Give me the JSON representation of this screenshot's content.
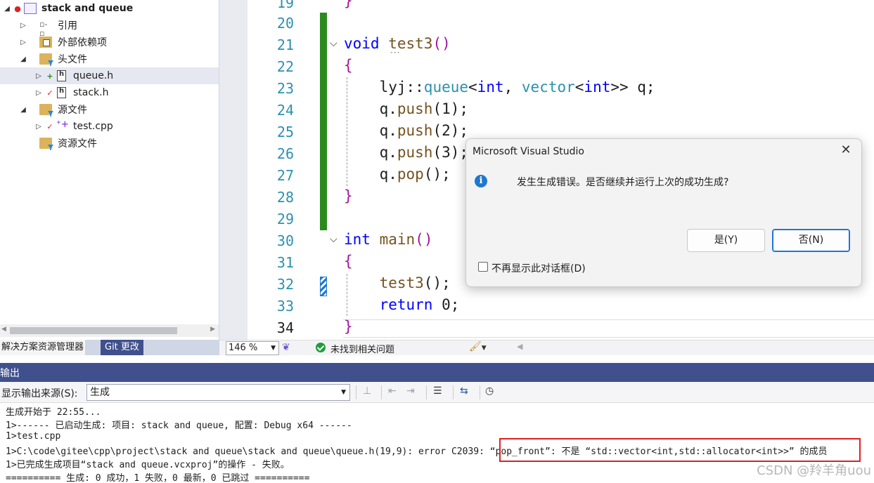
{
  "solution_explorer": {
    "project": "stack and queue",
    "items": [
      {
        "label": "stack and queue",
        "kind": "project"
      },
      {
        "label": "引用",
        "kind": "references"
      },
      {
        "label": "外部依赖项",
        "kind": "external"
      },
      {
        "label": "头文件",
        "kind": "folder"
      },
      {
        "label": "queue.h",
        "kind": "header",
        "status": "+"
      },
      {
        "label": "stack.h",
        "kind": "header",
        "status": "✓"
      },
      {
        "label": "源文件",
        "kind": "folder"
      },
      {
        "label": "test.cpp",
        "kind": "source",
        "status": "✓"
      },
      {
        "label": "资源文件",
        "kind": "folder"
      }
    ],
    "tabs": {
      "explorer": "解决方案资源管理器",
      "git": "Git 更改"
    }
  },
  "editor": {
    "line_numbers": [
      "19",
      "20",
      "21",
      "22",
      "23",
      "24",
      "25",
      "26",
      "27",
      "28",
      "29",
      "30",
      "31",
      "32",
      "33",
      "34"
    ],
    "lines": {
      "l21": {
        "kw": "void",
        "fn": "test3",
        "par": "()"
      },
      "l22": "{",
      "l23": {
        "ns": "lyj::",
        "ty": "queue",
        "lt": "<",
        "kw1": "int",
        "comma": ", ",
        "ty2": "vector",
        "lt2": "<",
        "kw2": "int",
        "rest": ">> q;"
      },
      "l24": {
        "obj": "q.",
        "fn": "push",
        "arg": "(1);"
      },
      "l25": {
        "obj": "q.",
        "fn": "push",
        "arg": "(2);"
      },
      "l26": {
        "obj": "q.",
        "fn": "push",
        "arg": "(3);"
      },
      "l27": {
        "obj": "q.",
        "fn": "pop",
        "arg": "();"
      },
      "l28": "}",
      "l30": {
        "kw": "int",
        "fn": "main",
        "par": "()"
      },
      "l31": "{",
      "l32": {
        "fn": "test3",
        "arg": "();"
      },
      "l33": {
        "kw": "return",
        "rest": " 0;"
      },
      "l34": "}"
    }
  },
  "status": {
    "zoom": "146 %",
    "issues": "未找到相关问题"
  },
  "output": {
    "title": "输出",
    "source_label": "显示输出来源(S):",
    "source_value": "生成",
    "lines": [
      "生成开始于 22:55...",
      "1>------ 已启动生成: 项目: stack and queue, 配置: Debug x64 ------",
      "1>test.cpp",
      "1>C:\\code\\gitee\\cpp\\project\\stack and queue\\stack and queue\\queue.h(19,9): error C2039: “pop_front”: 不是 “std::vector<int,std::allocator<int>>” 的成员",
      "1>已完成生成项目“stack and queue.vcxproj”的操作 - 失败。",
      "========== 生成: 0 成功，1 失败，0 最新，0 已跳过 =========="
    ],
    "watermark": "CSDN @羚羊角uou"
  },
  "dialog": {
    "title": "Microsoft Visual Studio",
    "message": "发生生成错误。是否继续并运行上次的成功生成?",
    "yes": "是(Y)",
    "no": "否(N)",
    "dont_show": "不再显示此对话框(D)"
  },
  "colors": {
    "accent": "#40508d",
    "keyword": "#0000ff",
    "type": "#2b91af",
    "function": "#74531f",
    "error_box": "#e02020",
    "change_bar": "#2b8a1e"
  }
}
